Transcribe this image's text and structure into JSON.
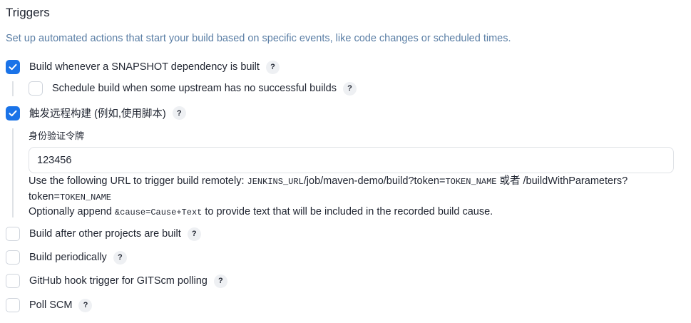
{
  "section": {
    "title": "Triggers",
    "description": "Set up automated actions that start your build based on specific events, like code changes or scheduled times."
  },
  "help_label": "?",
  "triggers": {
    "snapshot": {
      "label": "Build whenever a SNAPSHOT dependency is built",
      "checked": true
    },
    "upstream_schedule": {
      "label": "Schedule build when some upstream has no successful builds",
      "checked": false
    },
    "remote": {
      "label": "触发远程构建 (例如,使用脚本)",
      "checked": true
    },
    "after_other": {
      "label": "Build after other projects are built",
      "checked": false
    },
    "periodically": {
      "label": "Build periodically",
      "checked": false
    },
    "github_hook": {
      "label": "GitHub hook trigger for GITScm polling",
      "checked": false
    },
    "poll_scm": {
      "label": "Poll SCM",
      "checked": false
    }
  },
  "remote_config": {
    "token_label": "身份验证令牌",
    "token_value": "123456",
    "url_text_1": "Use the following URL to trigger build remotely: ",
    "url_code_1": "JENKINS_URL",
    "url_text_2": "/job/maven-demo/build?token=",
    "url_code_2": "TOKEN_NAME",
    "url_text_3": " 或者 /buildWithParameters?",
    "url_text_4": "token=",
    "url_code_3": "TOKEN_NAME",
    "append_text_1": "Optionally append ",
    "append_code": "&cause=Cause+Text",
    "append_text_2": " to provide text that will be included in the recorded build cause."
  },
  "colors": {
    "accent": "#1a73e8",
    "description": "#5a7ea5",
    "border": "#dfe2e6"
  }
}
